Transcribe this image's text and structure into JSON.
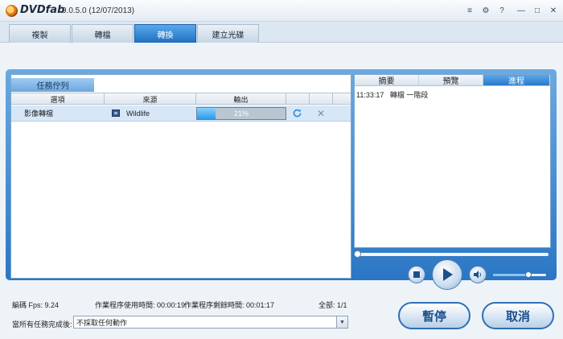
{
  "app": {
    "logo_text": "DVDfab",
    "version": "9.0.5.0 (12/07/2013)"
  },
  "window_controls": {
    "menu": "≡",
    "settings": "⚙",
    "help": "?",
    "minimize": "—",
    "maximize": "□",
    "close": "✕"
  },
  "tabs": [
    {
      "label": "複製",
      "active": false
    },
    {
      "label": "轉檔",
      "active": false
    },
    {
      "label": "轉換",
      "active": true
    },
    {
      "label": "建立光碟",
      "active": false
    }
  ],
  "queue": {
    "label": "任務佇列",
    "columns": {
      "option": "選項",
      "source": "來源",
      "output": "輸出"
    },
    "row": {
      "option": "影像轉檔",
      "source": "Wildlife",
      "progress_text": "21%",
      "progress_value": 0.21
    }
  },
  "right_tabs": [
    {
      "label": "摘要",
      "active": false
    },
    {
      "label": "預覽",
      "active": false
    },
    {
      "label": "進程",
      "active": true
    }
  ],
  "log": {
    "time": "11:33:17",
    "message": "轉檔 一階段"
  },
  "player": {
    "seek_value": 0.0,
    "volume_value": 0.67
  },
  "status": {
    "fps": "編碼 Fps: 9.24",
    "elapsed_label": "作業程序使用時間:",
    "elapsed_value": "00:00:19",
    "remaining_label": "作業程序剩餘時間:",
    "remaining_value": "00:01:17",
    "total_label": "全部:",
    "total_value": "1/1"
  },
  "after_finish": {
    "label": "當所有任務完成後:",
    "value": "不採取任何動作"
  },
  "buttons": {
    "pause": "暫停",
    "cancel": "取消"
  },
  "colors": {
    "accent": "#2b76c4",
    "progress": "#2a9be6"
  }
}
